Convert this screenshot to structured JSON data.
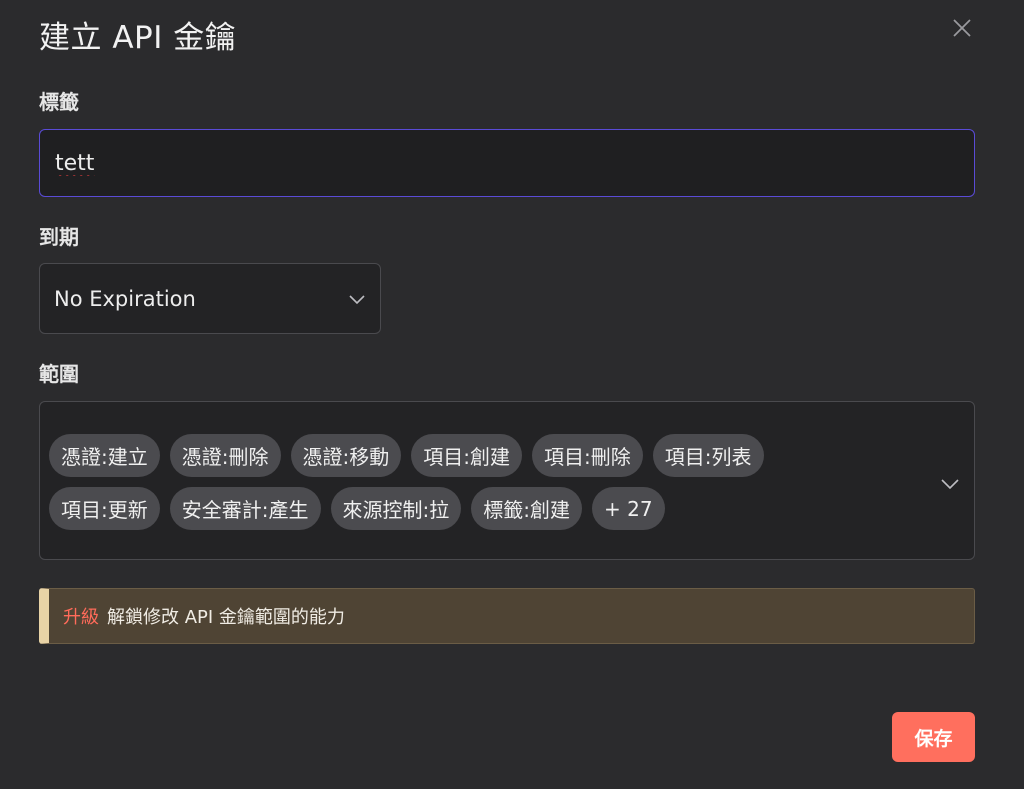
{
  "dialog": {
    "title": "建立 API 金鑰",
    "close_icon": "close-icon"
  },
  "label_field": {
    "label": "標籤",
    "value": "tett"
  },
  "expiration": {
    "label": "到期",
    "value": "No Expiration",
    "icon": "chevron-down-icon"
  },
  "scope": {
    "label": "範圍",
    "chips": [
      "憑證:建立",
      "憑證:刪除",
      "憑證:移動",
      "項目:創建",
      "項目:刪除",
      "項目:列表",
      "項目:更新",
      "安全審計:產生",
      "來源控制:拉",
      "標籤:創建",
      "+ 27"
    ],
    "icon": "chevron-down-icon"
  },
  "upgrade_banner": {
    "link": "升級",
    "text": "解鎖修改 API 金鑰範圍的能力"
  },
  "actions": {
    "save_label": "保存"
  },
  "colors": {
    "accent": "#ff6f5e",
    "input_focus_border": "#5a4bd6",
    "banner_bg": "#4f4434",
    "banner_bar": "#e8d3a6",
    "background": "#2b2b2d"
  }
}
